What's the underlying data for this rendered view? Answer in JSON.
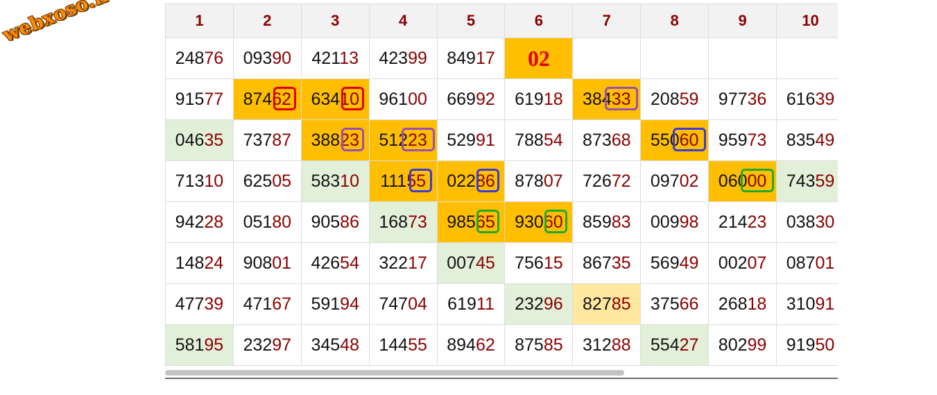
{
  "brand": {
    "logo_text": "webxoso.net"
  },
  "table": {
    "headers": [
      "1",
      "2",
      "3",
      "4",
      "5",
      "6",
      "7",
      "8",
      "9",
      "10"
    ],
    "special_value": "02",
    "rows": [
      [
        {
          "h": "248",
          "t": "76",
          "bg": ""
        },
        {
          "h": "093",
          "t": "90",
          "bg": ""
        },
        {
          "h": "421",
          "t": "13",
          "bg": ""
        },
        {
          "h": "423",
          "t": "99",
          "bg": ""
        },
        {
          "h": "849",
          "t": "17",
          "bg": ""
        },
        {
          "special": true
        },
        {
          "empty": true
        },
        {
          "empty": true
        },
        {
          "empty": true
        },
        {
          "empty": true
        }
      ],
      [
        {
          "h": "915",
          "t": "77",
          "bg": ""
        },
        {
          "h": "874",
          "t": "62",
          "bg": "hl",
          "mark": "red"
        },
        {
          "h": "634",
          "t": "10",
          "bg": "hl",
          "mark": "red"
        },
        {
          "h": "961",
          "t": "00",
          "bg": ""
        },
        {
          "h": "669",
          "t": "92",
          "bg": ""
        },
        {
          "h": "619",
          "t": "18",
          "bg": ""
        },
        {
          "h": "384",
          "t": "33",
          "bg": "hl",
          "mark": "purple",
          "wide": true
        },
        {
          "h": "208",
          "t": "59",
          "bg": ""
        },
        {
          "h": "977",
          "t": "36",
          "bg": ""
        },
        {
          "h": "616",
          "t": "39",
          "bg": ""
        }
      ],
      [
        {
          "h": "046",
          "t": "35",
          "bg": "gr"
        },
        {
          "h": "737",
          "t": "87",
          "bg": ""
        },
        {
          "h": "388",
          "t": "23",
          "bg": "hl",
          "mark": "purple"
        },
        {
          "h": "512",
          "t": "23",
          "bg": "hl",
          "mark": "purple",
          "wide": true
        },
        {
          "h": "529",
          "t": "91",
          "bg": ""
        },
        {
          "h": "788",
          "t": "54",
          "bg": ""
        },
        {
          "h": "873",
          "t": "68",
          "bg": ""
        },
        {
          "h": "550",
          "t": "60",
          "bg": "hl",
          "mark": "blue",
          "wide": true
        },
        {
          "h": "959",
          "t": "73",
          "bg": ""
        },
        {
          "h": "835",
          "t": "49",
          "bg": ""
        }
      ],
      [
        {
          "h": "713",
          "t": "10",
          "bg": ""
        },
        {
          "h": "625",
          "t": "05",
          "bg": ""
        },
        {
          "h": "583",
          "t": "10",
          "bg": "gr"
        },
        {
          "h": "111",
          "t": "55",
          "bg": "hl",
          "mark": "blue"
        },
        {
          "h": "022",
          "t": "86",
          "bg": "hl",
          "mark": "blue"
        },
        {
          "h": "878",
          "t": "07",
          "bg": ""
        },
        {
          "h": "726",
          "t": "72",
          "bg": ""
        },
        {
          "h": "097",
          "t": "02",
          "bg": ""
        },
        {
          "h": "060",
          "t": "00",
          "bg": "hl",
          "mark": "green",
          "wide": true
        },
        {
          "h": "743",
          "t": "59",
          "bg": "gr"
        }
      ],
      [
        {
          "h": "942",
          "t": "28",
          "bg": ""
        },
        {
          "h": "051",
          "t": "80",
          "bg": ""
        },
        {
          "h": "905",
          "t": "86",
          "bg": ""
        },
        {
          "h": "168",
          "t": "73",
          "bg": "gr"
        },
        {
          "h": "985",
          "t": "65",
          "bg": "hl",
          "mark": "green"
        },
        {
          "h": "930",
          "t": "60",
          "bg": "hl",
          "mark": "green"
        },
        {
          "h": "859",
          "t": "83",
          "bg": ""
        },
        {
          "h": "009",
          "t": "98",
          "bg": ""
        },
        {
          "h": "214",
          "t": "23",
          "bg": ""
        },
        {
          "h": "038",
          "t": "30",
          "bg": ""
        }
      ],
      [
        {
          "h": "148",
          "t": "24",
          "bg": ""
        },
        {
          "h": "908",
          "t": "01",
          "bg": ""
        },
        {
          "h": "426",
          "t": "54",
          "bg": ""
        },
        {
          "h": "322",
          "t": "17",
          "bg": ""
        },
        {
          "h": "007",
          "t": "45",
          "bg": "gr"
        },
        {
          "h": "756",
          "t": "15",
          "bg": ""
        },
        {
          "h": "867",
          "t": "35",
          "bg": ""
        },
        {
          "h": "569",
          "t": "49",
          "bg": ""
        },
        {
          "h": "002",
          "t": "07",
          "bg": ""
        },
        {
          "h": "087",
          "t": "01",
          "bg": ""
        }
      ],
      [
        {
          "h": "477",
          "t": "39",
          "bg": ""
        },
        {
          "h": "471",
          "t": "67",
          "bg": ""
        },
        {
          "h": "591",
          "t": "94",
          "bg": ""
        },
        {
          "h": "747",
          "t": "04",
          "bg": ""
        },
        {
          "h": "619",
          "t": "11",
          "bg": ""
        },
        {
          "h": "232",
          "t": "96",
          "bg": "gr"
        },
        {
          "h": "827",
          "t": "85",
          "bg": "lt"
        },
        {
          "h": "375",
          "t": "66",
          "bg": ""
        },
        {
          "h": "268",
          "t": "18",
          "bg": ""
        },
        {
          "h": "310",
          "t": "91",
          "bg": ""
        }
      ],
      [
        {
          "h": "581",
          "t": "95",
          "bg": "gr"
        },
        {
          "h": "232",
          "t": "97",
          "bg": ""
        },
        {
          "h": "345",
          "t": "48",
          "bg": ""
        },
        {
          "h": "144",
          "t": "55",
          "bg": ""
        },
        {
          "h": "894",
          "t": "62",
          "bg": ""
        },
        {
          "h": "875",
          "t": "85",
          "bg": ""
        },
        {
          "h": "312",
          "t": "88",
          "bg": ""
        },
        {
          "h": "554",
          "t": "27",
          "bg": "gr"
        },
        {
          "h": "802",
          "t": "99",
          "bg": ""
        },
        {
          "h": "919",
          "t": "50",
          "bg": ""
        }
      ]
    ]
  },
  "colors": {
    "highlight": "#ffbf00",
    "light_highlight": "#ffe9a0",
    "green_tint": "#e2f0d9",
    "tail_digits": "#8b0000",
    "header_text": "#8b0000",
    "mark_red": "#e00000",
    "mark_purple": "#9b4fb2",
    "mark_blue": "#3b3bd6",
    "mark_green": "#1faa2f"
  }
}
